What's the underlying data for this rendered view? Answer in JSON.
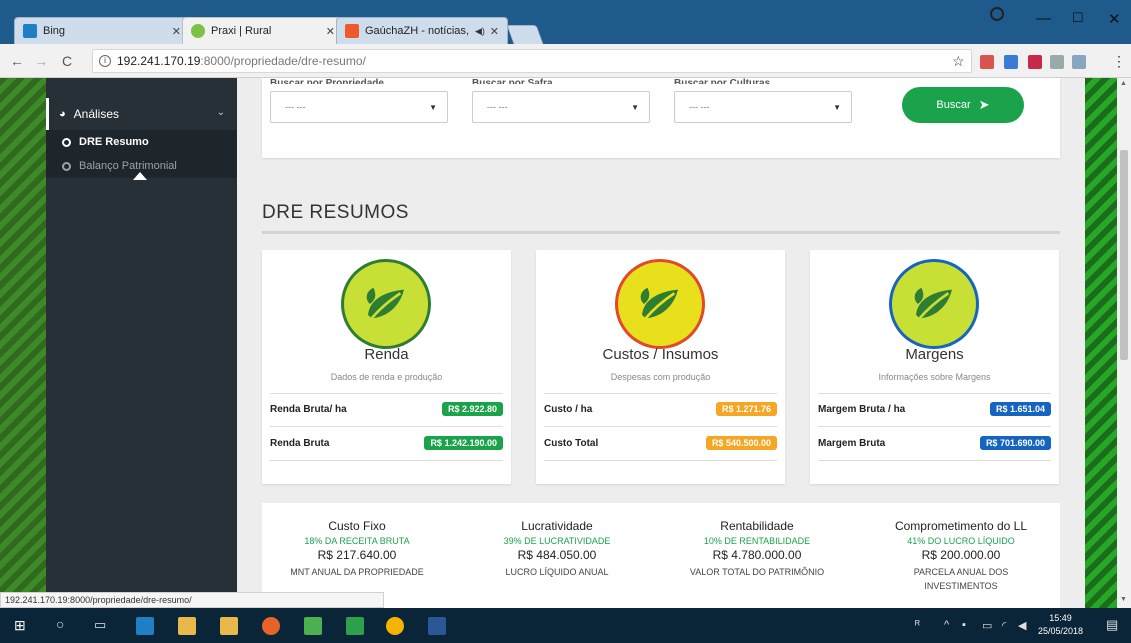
{
  "browser": {
    "tabs": [
      {
        "title": "Bing",
        "color": "#1e7fc4"
      },
      {
        "title": "Praxi | Rural",
        "color": "#7bc143"
      },
      {
        "title": "GaúchaZH - notícias,",
        "color": "#ef5a2a"
      }
    ],
    "url_host": "192.241.170.19",
    "url_path": ":8000/propriedade/dre-resumo/",
    "status_url": "192.241.170.19:8000/propriedade/dre-resumo/"
  },
  "sidebar": {
    "section": "Análises",
    "items": [
      {
        "label": "DRE Resumo"
      },
      {
        "label": "Balanço Patrimonial"
      }
    ]
  },
  "filters": {
    "labels": [
      "Buscar por Propriedade",
      "Buscar por Safra",
      "Buscar por Culturas"
    ],
    "selects": [
      {
        "value": "--- ---"
      },
      {
        "value": "--- ---"
      },
      {
        "value": "--- ---"
      }
    ],
    "search_button": "Buscar"
  },
  "section_title": "DRE RESUMOS",
  "cards": [
    {
      "title": "Renda",
      "subtitle": "Dados de renda e produção",
      "rows": [
        {
          "label": "Renda Bruta/ ha",
          "value": "R$ 2.922.80"
        },
        {
          "label": "Renda Bruta",
          "value": "R$ 1.242.190.00"
        }
      ],
      "badge_color": "#1aa34a",
      "icon_bg": "#c8e035",
      "icon_ring": "#2e7d32"
    },
    {
      "title": "Custos / Insumos",
      "subtitle": "Despesas com produção",
      "rows": [
        {
          "label": "Custo / ha",
          "value": "R$ 1.271.76"
        },
        {
          "label": "Custo Total",
          "value": "R$ 540.500.00"
        }
      ],
      "badge_color": "#f5a623",
      "icon_bg": "#e8e01c",
      "icon_ring": "#e04a2a"
    },
    {
      "title": "Margens",
      "subtitle": "Informações sobre Margens",
      "rows": [
        {
          "label": "Margem Bruta / ha",
          "value": "R$ 1.651.04"
        },
        {
          "label": "Margem Bruta",
          "value": "R$ 701.690.00"
        }
      ],
      "badge_color": "#1565c0",
      "icon_bg": "#c8e035",
      "icon_ring": "#1565c0"
    }
  ],
  "metrics": [
    {
      "title": "Custo Fixo",
      "pct": "18% DA RECEITA BRUTA",
      "value": "R$ 217.640.00",
      "desc": "MNT ANUAL DA PROPRIEDADE"
    },
    {
      "title": "Lucratividade",
      "pct": "39% DE LUCRATIVIDADE",
      "value": "R$ 484.050.00",
      "desc": "LUCRO LÍQUIDO ANUAL"
    },
    {
      "title": "Rentabilidade",
      "pct": "10% DE RENTABILIDADE",
      "value": "R$ 4.780.000.00",
      "desc": "VALOR TOTAL DO PATRIMÔNIO"
    },
    {
      "title": "Comprometimento do LL",
      "pct": "41% DO LUCRO LÍQUIDO",
      "value": "R$ 200.000.00",
      "desc": "PARCELA ANUAL DOS INVESTIMENTOS"
    }
  ],
  "taskbar": {
    "time": "15:49",
    "date": "25/05/2018"
  }
}
